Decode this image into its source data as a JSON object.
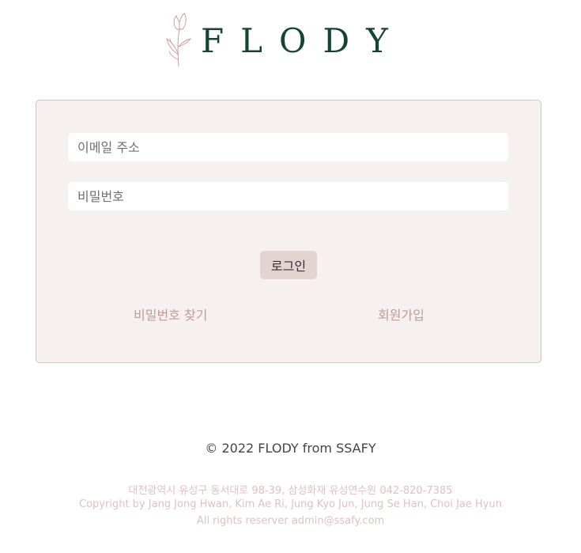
{
  "logo": {
    "text": "FLODY",
    "icon": "tulip-icon"
  },
  "login_form": {
    "email_placeholder": "이메일 주소",
    "password_placeholder": "비밀번호",
    "login_button": "로그인",
    "find_password_link": "비밀번호 찾기",
    "signup_link": "회원가입"
  },
  "footer": {
    "copyright": "© 2022 FLODY from SSAFY",
    "address": "대전광역시 유성구 동서대로 98-39, 삼성화재 유성연수원 042-820-7385",
    "credits": "Copyright by Jang Jong Hwan, Kim Ae Ri, Jung Kyo Jun, Jung Se Han, Choi Jae Hyun",
    "rights": "All rights reserver admin@ssafy.com"
  },
  "colors": {
    "brand": "#14452f",
    "card_background": "#f6f1f0",
    "button_background": "#e4d4d1",
    "link": "#c49a94",
    "footer_muted": "#ddc2bf"
  }
}
